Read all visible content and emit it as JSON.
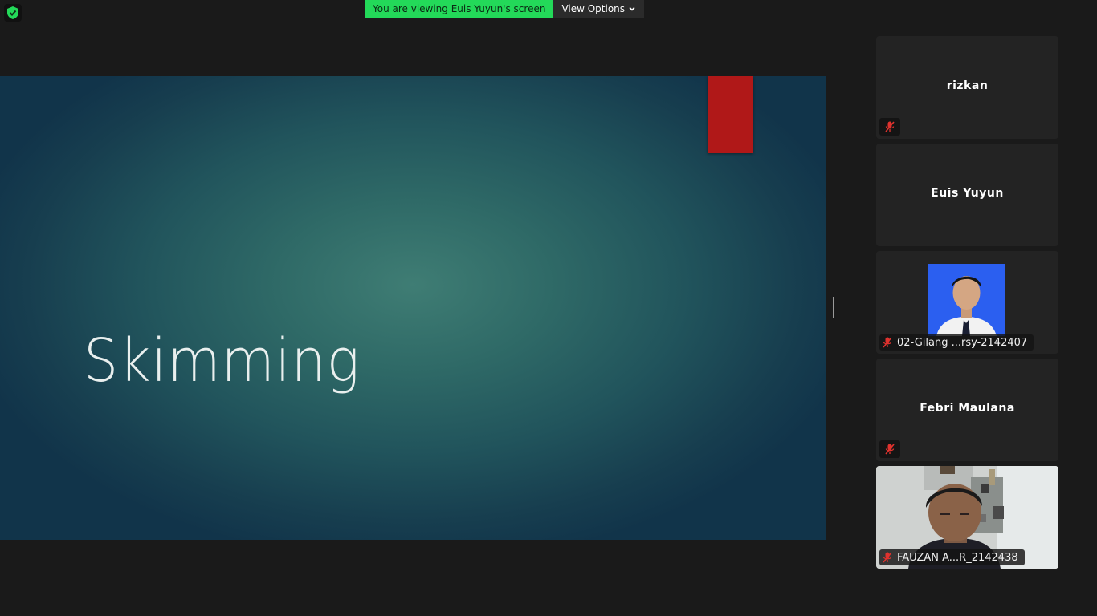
{
  "banner": {
    "viewing_text": "You are viewing Euis Yuyun's screen",
    "view_options_label": "View Options"
  },
  "slide": {
    "title": "Skimming",
    "accent_color": "#b01818"
  },
  "participants": [
    {
      "name": "rizkan",
      "muted": true,
      "video": false
    },
    {
      "name": "Euis Yuyun",
      "muted": false,
      "video": false
    },
    {
      "name": "02-Gilang ...rsy-2142407",
      "muted": true,
      "video": true
    },
    {
      "name": "Febri Maulana",
      "muted": true,
      "video": false
    },
    {
      "name": "FAUZAN A...R_2142438",
      "muted": true,
      "video": true
    }
  ],
  "colors": {
    "banner_green": "#23d959",
    "background": "#1a1a1a",
    "tile_background": "#232323",
    "mute_red": "#e0322e"
  }
}
